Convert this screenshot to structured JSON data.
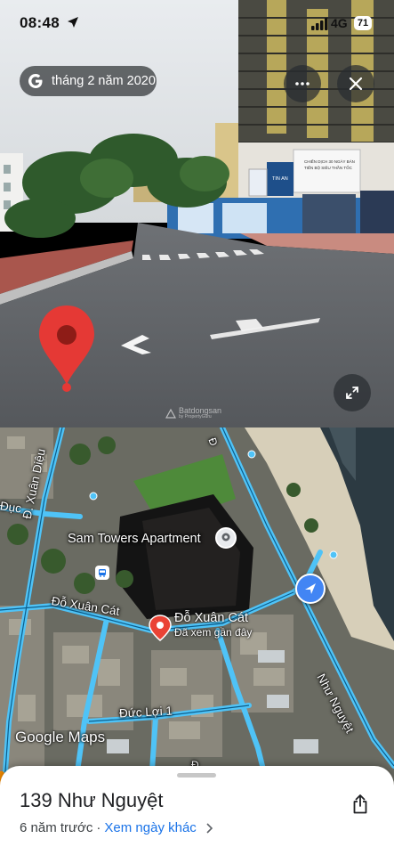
{
  "status_bar": {
    "time": "08:48",
    "network": "4G",
    "battery": "71"
  },
  "streetview": {
    "date_label": "tháng 2 năm 2020",
    "billboard_lines": [
      "CHIẾN DỊCH 30 NGÀY BÁN",
      "TIẾN BỘ SIÊU THẦN TỐC"
    ],
    "billboard_brand": "TIN AN",
    "watermark_brand": "Batdongsan",
    "watermark_sub": "by PropertyGuru"
  },
  "map": {
    "poi_name": "Sam Towers Apartment",
    "streets": {
      "do_xuan_cat": "Đỗ Xuân Cát",
      "duc_loi": "Đức Lợi 1",
      "nhu_nguyet": "Như Nguyệt",
      "xuan_dieu": "Đ. Xuân Diệu",
      "duc": "Đục",
      "b": "Đ",
      "n": "Đ"
    },
    "pin_title": "Đỗ Xuân Cát",
    "pin_subtitle": "Đã xem gần đây",
    "logo": "Google Maps"
  },
  "sheet": {
    "title": "139 Như Nguyệt",
    "age": "6 năm trước",
    "separator": "·",
    "link": "Xem ngày khác"
  },
  "colors": {
    "road_blue": "#4fc3f7",
    "pin_red": "#ea4335",
    "link_blue": "#1a73e8"
  }
}
